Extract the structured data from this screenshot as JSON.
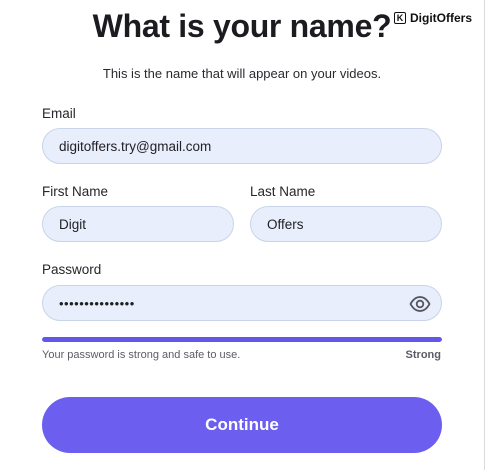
{
  "header": {
    "title": "What is your name?",
    "subtitle": "This is the name that will appear on your videos."
  },
  "watermark": {
    "icon": "digitoffers-logo-icon",
    "text": "DigitOffers"
  },
  "form": {
    "email_label": "Email",
    "email_value": "digitoffers.try@gmail.com",
    "first_name_label": "First Name",
    "first_name_value": "Digit",
    "last_name_label": "Last Name",
    "last_name_value": "Offers",
    "password_label": "Password",
    "password_masked": "•••••••••••••••",
    "password_toggle_icon": "eye-icon",
    "strength_fraction": 1.0,
    "strength_hint": "Your password is strong and safe to use.",
    "strength_label": "Strong",
    "continue_label": "Continue"
  },
  "colors": {
    "accent": "#6c5ff0",
    "field_bg": "#e8eefb",
    "field_border": "#c9d3ea",
    "strength_bar": "#6257ea"
  }
}
